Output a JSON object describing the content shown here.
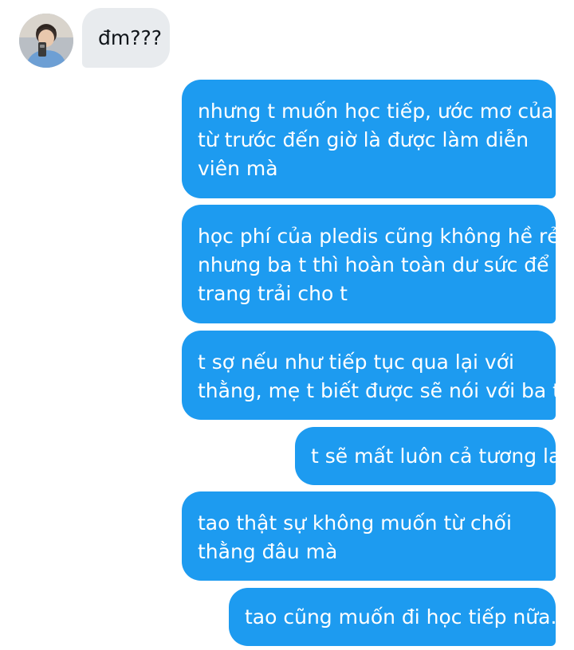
{
  "conversation": {
    "incoming": [
      {
        "text": "đm???",
        "sender_avatar_icon": "person-avatar-icon"
      }
    ],
    "outgoing": [
      {
        "lines": [
          "nhưng t muốn học tiếp, ước mơ của t",
          "từ trước đến giờ là được làm diễn",
          "viên mà"
        ]
      },
      {
        "lines": [
          "học phí của pledis cũng không hề rẻ,",
          "nhưng ba t thì hoàn toàn dư sức để",
          "trang trải cho t"
        ]
      },
      {
        "lines": [
          "t sợ nếu như tiếp tục qua lại với",
          "thằng, mẹ t biết được sẽ nói với ba t"
        ]
      },
      {
        "lines": [
          "t sẽ mất luôn cả tương lai"
        ]
      },
      {
        "lines": [
          "tao thật sự không muốn từ chối",
          "thằng đâu mà"
        ]
      },
      {
        "lines": [
          "tao cũng muốn đi học tiếp nữa..."
        ]
      }
    ]
  },
  "colors": {
    "outgoing_bubble": "#1d9bf0",
    "incoming_bubble": "#e8ebee",
    "outgoing_text": "#ffffff",
    "incoming_text": "#0f1419",
    "background": "#ffffff"
  }
}
